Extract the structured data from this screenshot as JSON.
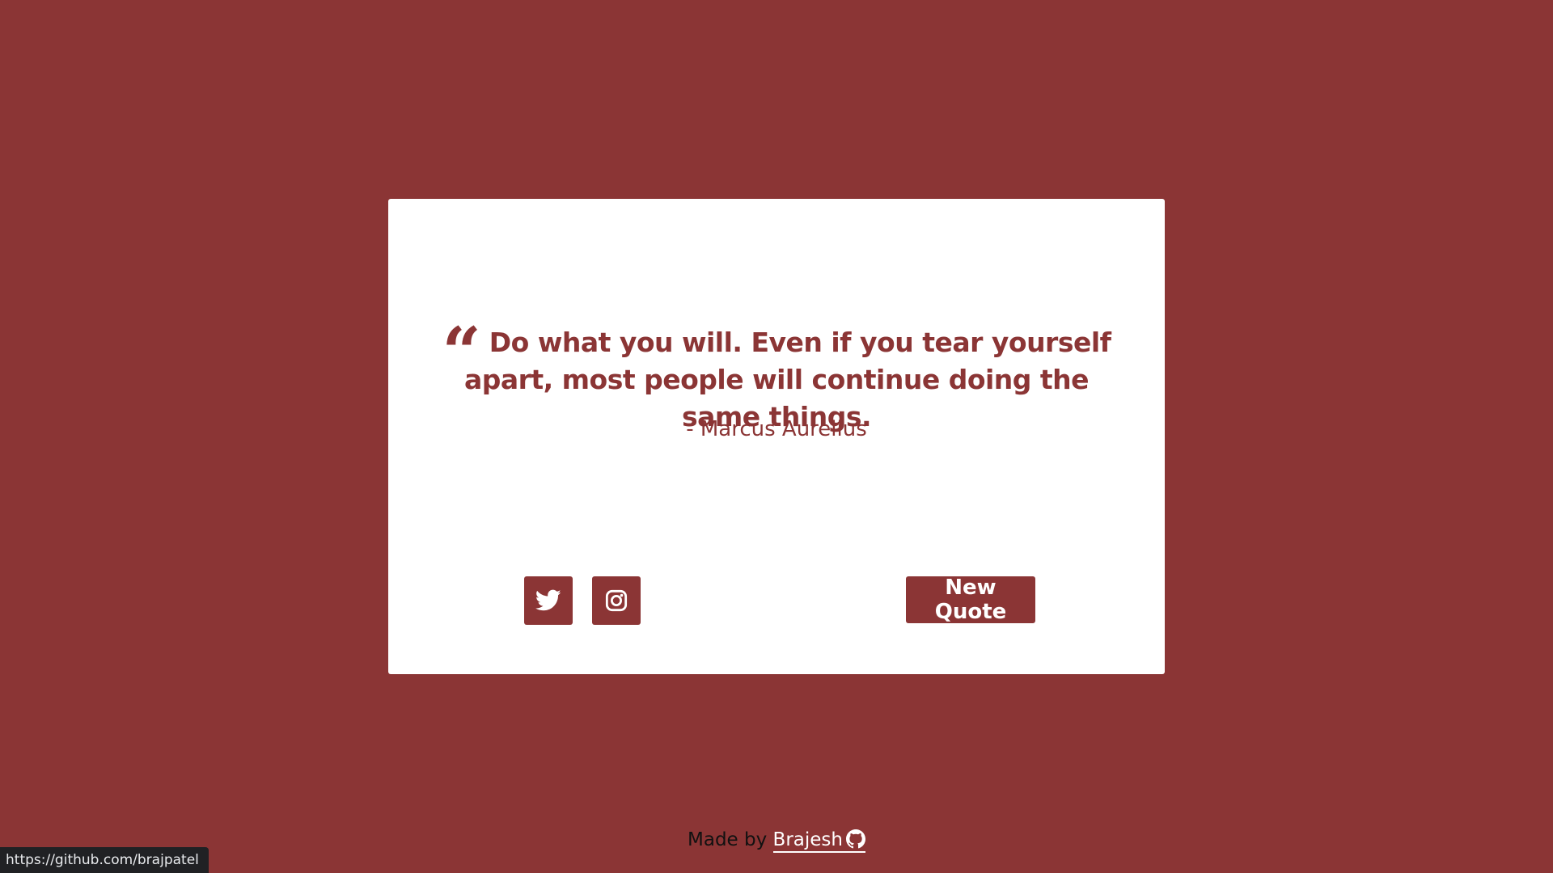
{
  "colors": {
    "background": "#8b3535",
    "accent": "#8b3535",
    "card": "#ffffff"
  },
  "quote": {
    "mark": "“",
    "text": "Do what you will. Even if you tear yourself apart, most people will continue doing the same things.",
    "author": "- Marcus Aurelius"
  },
  "actions": {
    "twitter_icon": "twitter-icon",
    "instagram_icon": "instagram-icon",
    "new_quote_label": "New Quote"
  },
  "footer": {
    "made_by": "Made by",
    "author_link": "Brajesh",
    "github_icon": "github-icon"
  },
  "status_bar": {
    "url": "https://github.com/brajpatel"
  }
}
